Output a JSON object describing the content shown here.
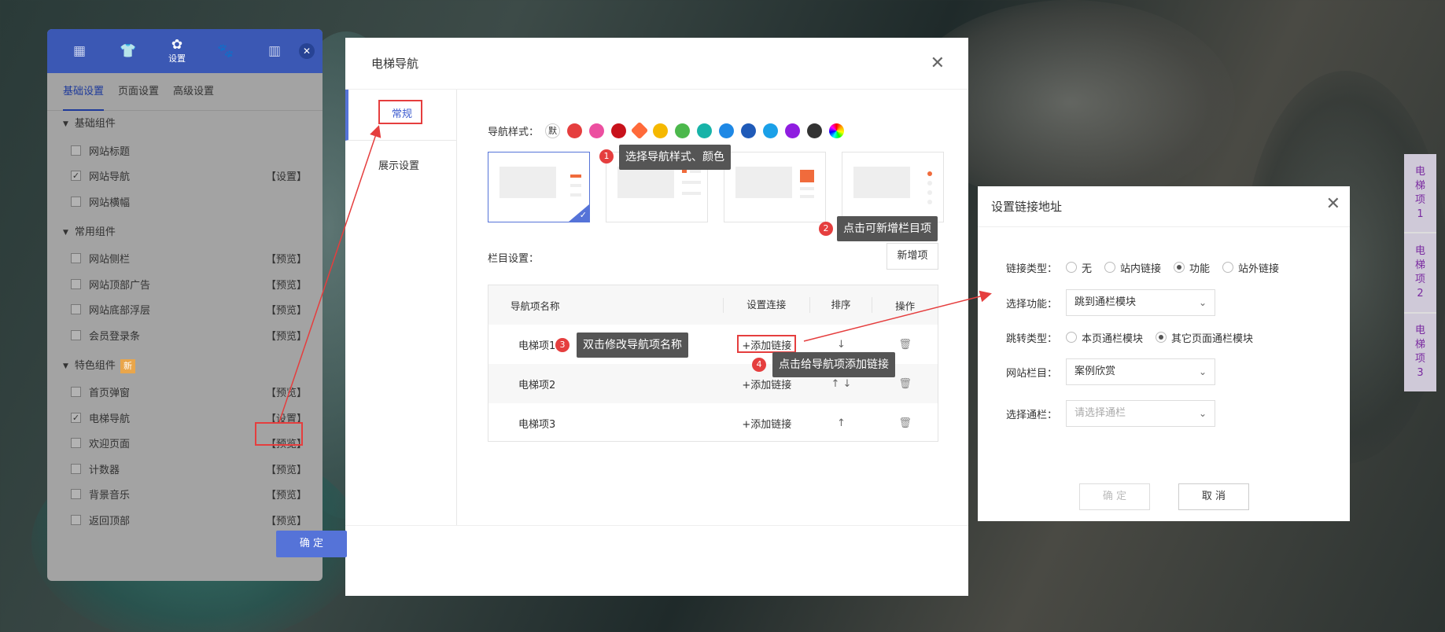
{
  "left_panel": {
    "tabs": [
      {
        "icon": "grid-icon",
        "glyph": "▦",
        "label": ""
      },
      {
        "icon": "shirt-icon",
        "glyph": "👕",
        "label": ""
      },
      {
        "icon": "gear-icon",
        "glyph": "✿",
        "label": "设置"
      },
      {
        "icon": "paw-icon",
        "glyph": "🐾",
        "label": ""
      },
      {
        "icon": "blocks-icon",
        "glyph": "▥",
        "label": ""
      }
    ],
    "close_glyph": "✕",
    "subtabs": [
      "基础设置",
      "页面设置",
      "高级设置"
    ],
    "sections": [
      {
        "title": "基础组件",
        "badge": "",
        "items": [
          {
            "label": "网站标题",
            "checked": false,
            "action": ""
          },
          {
            "label": "网站导航",
            "checked": true,
            "action": "【设置】"
          },
          {
            "label": "网站横幅",
            "checked": false,
            "action": ""
          }
        ]
      },
      {
        "title": "常用组件",
        "badge": "",
        "items": [
          {
            "label": "网站侧栏",
            "checked": false,
            "action": "【预览】"
          },
          {
            "label": "网站顶部广告",
            "checked": false,
            "action": "【预览】"
          },
          {
            "label": "网站底部浮层",
            "checked": false,
            "action": "【预览】"
          },
          {
            "label": "会员登录条",
            "checked": false,
            "action": "【预览】"
          }
        ]
      },
      {
        "title": "特色组件",
        "badge": "新",
        "items": [
          {
            "label": "首页弹窗",
            "checked": false,
            "action": "【预览】"
          },
          {
            "label": "电梯导航",
            "checked": true,
            "action": "【设置】"
          },
          {
            "label": "欢迎页面",
            "checked": false,
            "action": "【预览】"
          },
          {
            "label": "计数器",
            "checked": false,
            "action": "【预览】"
          },
          {
            "label": "背景音乐",
            "checked": false,
            "action": "【预览】"
          },
          {
            "label": "返回顶部",
            "checked": false,
            "action": "【预览】"
          }
        ]
      }
    ]
  },
  "main_dialog": {
    "title": "电梯导航",
    "close_glyph": "✕",
    "nav": [
      "常规",
      "展示设置"
    ],
    "style_label": "导航样式：",
    "default_swatch": "默",
    "colors": [
      "#e53e3e",
      "#ec4fa0",
      "#c8121b",
      "#ff6a3a",
      "#f5b800",
      "#4cb84c",
      "#17b3a8",
      "#1e88e5",
      "#1f5ab8",
      "#1aa0e8",
      "#8f1de0",
      "#333333"
    ],
    "column_label": "栏目设置：",
    "new_item_button": "新增项",
    "table": {
      "headers": [
        "导航项名称",
        "设置连接",
        "排序",
        "操作"
      ],
      "rows": [
        {
          "name": "电梯项1",
          "link": "+添加链接",
          "sort": "↓"
        },
        {
          "name": "电梯项2",
          "link": "+添加链接",
          "sort": "↑ ↓"
        },
        {
          "name": "电梯项3",
          "link": "+添加链接",
          "sort": "↑"
        }
      ],
      "trash_glyph": "🗑"
    },
    "confirm_button": "确 定"
  },
  "tips": {
    "t1": {
      "num": "1",
      "text": "选择导航样式、颜色"
    },
    "t2": {
      "num": "2",
      "text": "点击可新增栏目项"
    },
    "t3": {
      "num": "3",
      "text": "双击修改导航项名称"
    },
    "t4": {
      "num": "4",
      "text": "点击给导航项添加链接"
    }
  },
  "link_dialog": {
    "title": "设置链接地址",
    "close_glyph": "✕",
    "link_type_label": "链接类型：",
    "link_type_options": [
      {
        "label": "无",
        "on": false
      },
      {
        "label": "站内链接",
        "on": false
      },
      {
        "label": "功能",
        "on": true
      },
      {
        "label": "站外链接",
        "on": false
      }
    ],
    "function_label": "选择功能：",
    "function_value": "跳到通栏模块",
    "jump_type_label": "跳转类型：",
    "jump_type_options": [
      {
        "label": "本页通栏模块",
        "on": false
      },
      {
        "label": "其它页面通栏模块",
        "on": true
      }
    ],
    "column_label": "网站栏目：",
    "column_value": "案例欣赏",
    "bar_label": "选择通栏：",
    "bar_placeholder": "请选择通栏",
    "ok_button": "确 定",
    "cancel_button": "取 消"
  },
  "elevator_strip": [
    "电梯项1",
    "电梯项2",
    "电梯项3"
  ],
  "accent_color": "#5573d8",
  "highlight_color": "#e53e3e"
}
